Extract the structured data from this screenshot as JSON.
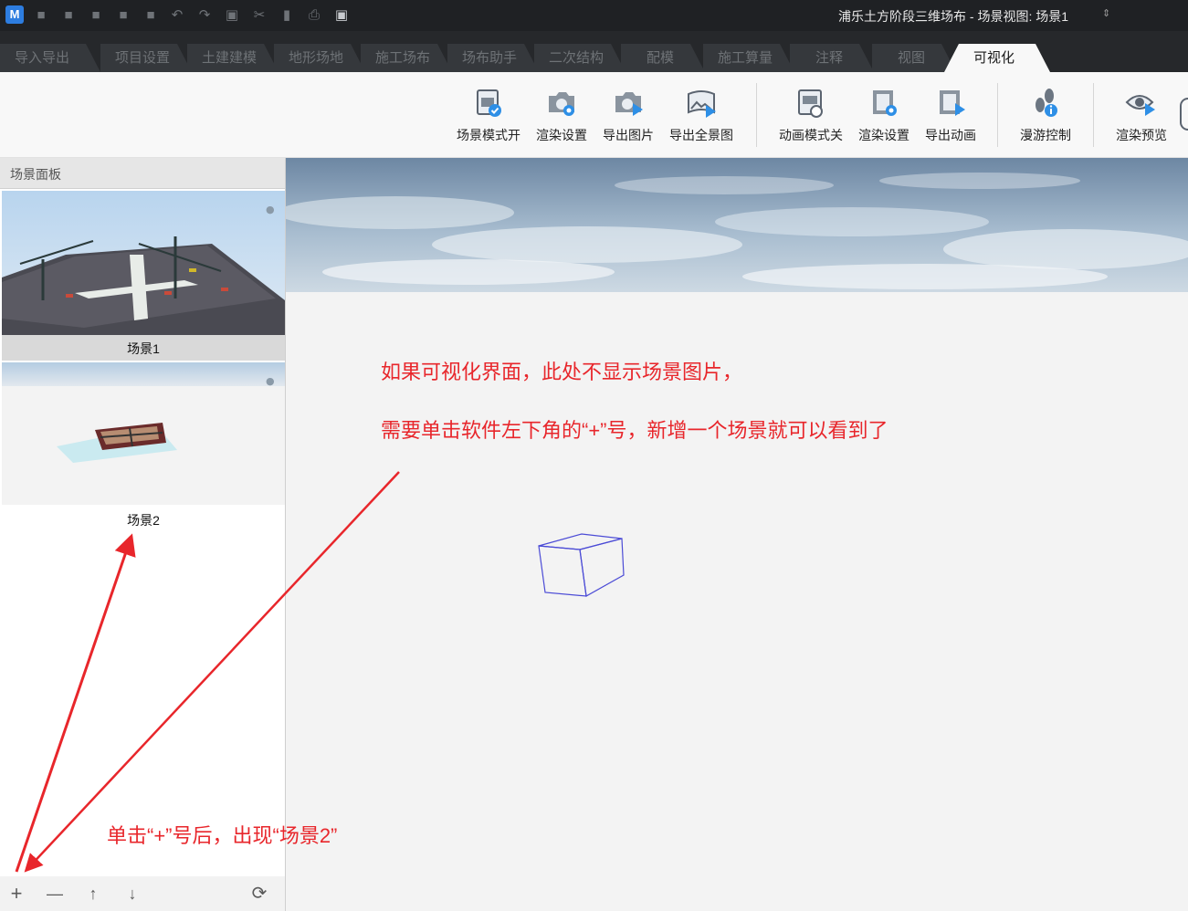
{
  "app": {
    "logo_text": "M",
    "window_title": "浦乐土方阶段三维场布 - 场景视图: 场景1"
  },
  "quick_access_icons": [
    "new-file-icon",
    "open-file-icon",
    "save-icon",
    "save-as-icon",
    "copy-doc-icon",
    "undo-icon",
    "redo-icon",
    "select-icon",
    "cut-icon",
    "paste-icon",
    "print-icon",
    "cube-icon"
  ],
  "tabs": [
    {
      "label": "导入导出",
      "active": false
    },
    {
      "label": "项目设置",
      "active": false
    },
    {
      "label": "土建建模",
      "active": false
    },
    {
      "label": "地形场地",
      "active": false
    },
    {
      "label": "施工场布",
      "active": false
    },
    {
      "label": "场布助手",
      "active": false
    },
    {
      "label": "二次结构",
      "active": false
    },
    {
      "label": "配模",
      "active": false
    },
    {
      "label": "施工算量",
      "active": false
    },
    {
      "label": "注释",
      "active": false
    },
    {
      "label": "视图",
      "active": false
    },
    {
      "label": "可视化",
      "active": true
    }
  ],
  "ribbon": {
    "buttons": [
      {
        "label": "场景模式开",
        "icon": "scene-mode-icon"
      },
      {
        "label": "渲染设置",
        "icon": "render-settings-icon"
      },
      {
        "label": "导出图片",
        "icon": "export-image-icon"
      },
      {
        "label": "导出全景图",
        "icon": "export-panorama-icon"
      },
      {
        "label": "动画模式关",
        "icon": "animation-mode-icon"
      },
      {
        "label": "渲染设置",
        "icon": "animation-render-settings-icon"
      },
      {
        "label": "导出动画",
        "icon": "export-animation-icon"
      },
      {
        "label": "漫游控制",
        "icon": "roam-control-icon"
      },
      {
        "label": "渲染预览",
        "icon": "render-preview-icon"
      }
    ]
  },
  "scene_panel": {
    "title": "场景面板",
    "scenes": [
      {
        "label": "场景1",
        "selected": true
      },
      {
        "label": "场景2",
        "selected": false
      }
    ],
    "toolbar": {
      "add": "+",
      "remove": "—",
      "move_up": "↑",
      "move_down": "↓",
      "refresh": "⟳"
    }
  },
  "annotations": {
    "note1": "如果可视化界面，此处不显示场景图片，",
    "note2": "需要单击软件左下角的“+”号，新增一个场景就可以看到了",
    "note3": "单击“+”号后，出现“场景2”",
    "color": "#e8262b"
  }
}
